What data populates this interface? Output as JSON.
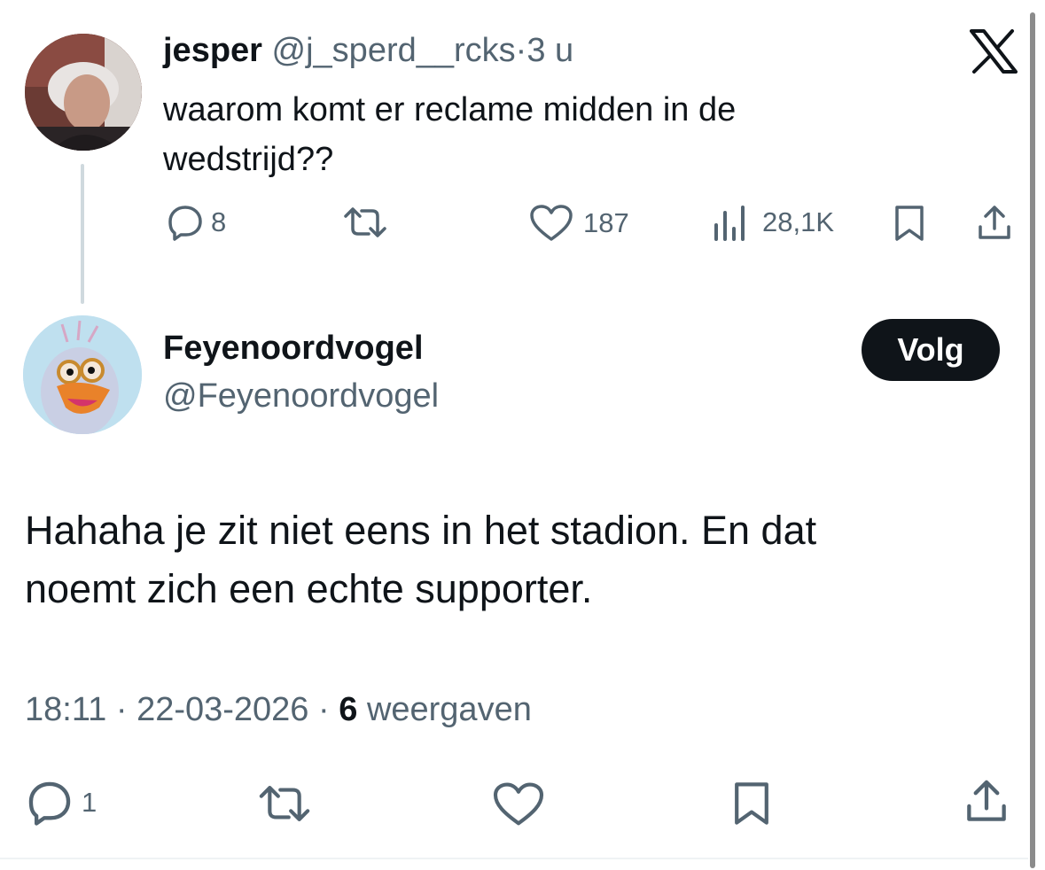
{
  "parent_tweet": {
    "display_name": "jesper",
    "handle": "@j_sperd__rcks",
    "separator": "·",
    "time": "3 u",
    "text_line1": "waarom komt er reclame midden in de",
    "text_line2": "wedstrijd??",
    "metrics": {
      "replies": "8",
      "likes": "187",
      "views": "28,1K"
    }
  },
  "main_tweet": {
    "display_name": "Feyenoordvogel",
    "handle": "@Feyenoordvogel",
    "follow_label": "Volg",
    "text_line1": "Hahaha je zit niet eens in het stadion. En dat",
    "text_line2": "noemt zich een echte supporter.",
    "time": "18:11",
    "separator": "·",
    "date": "22-03-2026",
    "views_count": "6",
    "views_label": "weergaven",
    "metrics": {
      "replies": "1"
    }
  },
  "icons": {
    "logo": "x-logo-icon",
    "reply": "reply-icon",
    "retweet": "retweet-icon",
    "like": "heart-icon",
    "views": "views-icon",
    "bookmark": "bookmark-icon",
    "share": "share-icon"
  },
  "colors": {
    "text_primary": "#0f1419",
    "text_secondary": "#536471",
    "follow_button_bg": "#0f1419",
    "thread_line": "#cfd9de"
  }
}
